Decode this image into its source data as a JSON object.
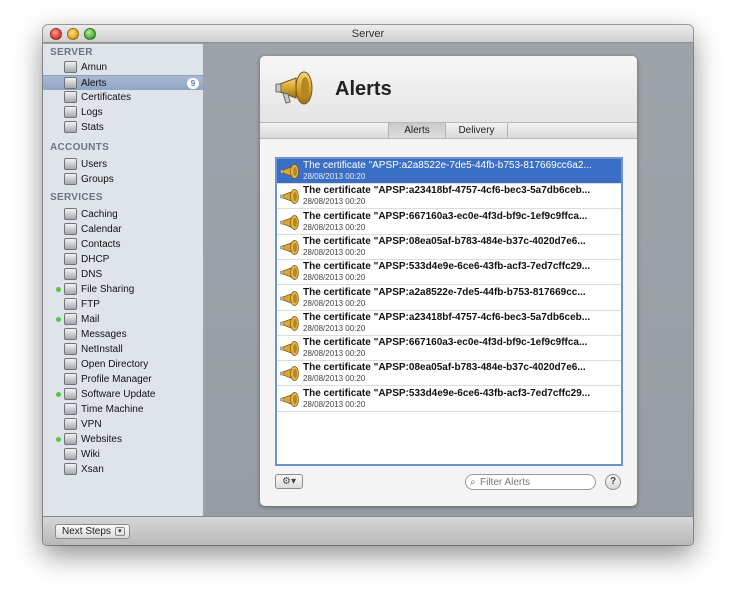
{
  "window": {
    "title": "Server"
  },
  "sidebar": {
    "sections": [
      {
        "title": "SERVER",
        "items": [
          {
            "label": "Amun",
            "icon": "server-icon"
          },
          {
            "label": "Alerts",
            "icon": "alerts-icon",
            "badge": "9",
            "selected": true
          },
          {
            "label": "Certificates",
            "icon": "certificate-icon"
          },
          {
            "label": "Logs",
            "icon": "logs-icon"
          },
          {
            "label": "Stats",
            "icon": "stats-icon"
          }
        ]
      },
      {
        "title": "ACCOUNTS",
        "items": [
          {
            "label": "Users",
            "icon": "user-icon"
          },
          {
            "label": "Groups",
            "icon": "group-icon"
          }
        ]
      },
      {
        "title": "SERVICES",
        "items": [
          {
            "label": "Caching",
            "icon": "caching-icon"
          },
          {
            "label": "Calendar",
            "icon": "calendar-icon"
          },
          {
            "label": "Contacts",
            "icon": "contacts-icon"
          },
          {
            "label": "DHCP",
            "icon": "dhcp-icon"
          },
          {
            "label": "DNS",
            "icon": "dns-icon"
          },
          {
            "label": "File Sharing",
            "icon": "file-sharing-icon",
            "running": true
          },
          {
            "label": "FTP",
            "icon": "ftp-icon"
          },
          {
            "label": "Mail",
            "icon": "mail-icon",
            "running": true
          },
          {
            "label": "Messages",
            "icon": "messages-icon"
          },
          {
            "label": "NetInstall",
            "icon": "netinstall-icon"
          },
          {
            "label": "Open Directory",
            "icon": "open-directory-icon"
          },
          {
            "label": "Profile Manager",
            "icon": "profile-manager-icon"
          },
          {
            "label": "Software Update",
            "icon": "software-update-icon",
            "running": true
          },
          {
            "label": "Time Machine",
            "icon": "time-machine-icon"
          },
          {
            "label": "VPN",
            "icon": "vpn-icon"
          },
          {
            "label": "Websites",
            "icon": "websites-icon",
            "running": true
          },
          {
            "label": "Wiki",
            "icon": "wiki-icon"
          },
          {
            "label": "Xsan",
            "icon": "xsan-icon"
          }
        ]
      }
    ]
  },
  "panel": {
    "title": "Alerts",
    "icon": "megaphone-icon",
    "tabs": [
      {
        "label": "Alerts",
        "active": true
      },
      {
        "label": "Delivery",
        "active": false
      }
    ],
    "alerts": [
      {
        "text": "The certificate \"APSP:a2a8522e-7de5-44fb-b753-817669cc6a2...",
        "date": "28/08/2013 00:20",
        "selected": true
      },
      {
        "text": "The certificate \"APSP:a23418bf-4757-4cf6-bec3-5a7db6ceb...",
        "date": "28/08/2013 00:20"
      },
      {
        "text": "The certificate \"APSP:667160a3-ec0e-4f3d-bf9c-1ef9c9ffca...",
        "date": "28/08/2013 00:20"
      },
      {
        "text": "The certificate \"APSP:08ea05af-b783-484e-b37c-4020d7e6...",
        "date": "28/08/2013 00:20"
      },
      {
        "text": "The certificate \"APSP:533d4e9e-6ce6-43fb-acf3-7ed7cffc29...",
        "date": "28/08/2013 00:20"
      },
      {
        "text": "The certificate \"APSP:a2a8522e-7de5-44fb-b753-817669cc...",
        "date": "28/08/2013 00:20"
      },
      {
        "text": "The certificate \"APSP:a23418bf-4757-4cf6-bec3-5a7db6ceb...",
        "date": "28/08/2013 00:20"
      },
      {
        "text": "The certificate \"APSP:667160a3-ec0e-4f3d-bf9c-1ef9c9ffca...",
        "date": "28/08/2013 00:20"
      },
      {
        "text": "The certificate \"APSP:08ea05af-b783-484e-b37c-4020d7e6...",
        "date": "28/08/2013 00:20"
      },
      {
        "text": "The certificate \"APSP:533d4e9e-6ce6-43fb-acf3-7ed7cffc29...",
        "date": "28/08/2013 00:20"
      }
    ],
    "filter_placeholder": "Filter Alerts",
    "gear_label": "⚙▾",
    "help_label": "?"
  },
  "bottom": {
    "next_steps_label": "Next Steps"
  },
  "colors": {
    "selection": "#3b6fc6",
    "running_dot": "#57c53d",
    "list_border": "#6e94cc"
  }
}
